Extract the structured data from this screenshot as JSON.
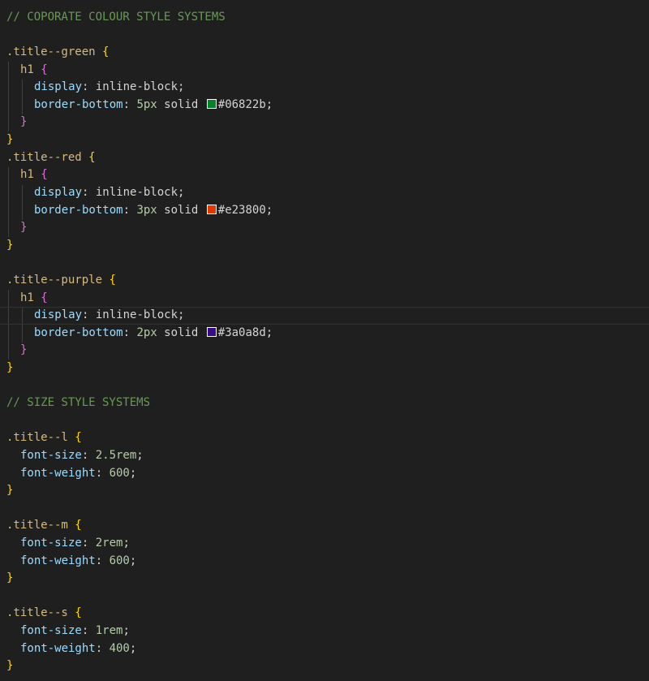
{
  "editor": {
    "comments": {
      "colour": "// COPORATE COLOUR STYLE SYSTEMS",
      "size": "// SIZE STYLE SYSTEMS"
    },
    "rules": {
      "green": {
        "selector": ".title--green",
        "tag": "h1",
        "display_prop": "display",
        "display_value": "inline-block",
        "border_prop": "border-bottom",
        "border_width": "5px",
        "border_style": "solid",
        "border_color": "#06822b"
      },
      "red": {
        "selector": ".title--red",
        "tag": "h1",
        "display_prop": "display",
        "display_value": "inline-block",
        "border_prop": "border-bottom",
        "border_width": "3px",
        "border_style": "solid",
        "border_color": "#e23800"
      },
      "purple": {
        "selector": ".title--purple",
        "tag": "h1",
        "display_prop": "display",
        "display_value": "inline-block",
        "border_prop": "border-bottom",
        "border_width": "2px",
        "border_style": "solid",
        "border_color": "#3a0a8d"
      },
      "l": {
        "selector": ".title--l",
        "size_prop": "font-size",
        "size_value": "2.5rem",
        "weight_prop": "font-weight",
        "weight_value": "600"
      },
      "m": {
        "selector": ".title--m",
        "size_prop": "font-size",
        "size_value": "2rem",
        "weight_prop": "font-weight",
        "weight_value": "600"
      },
      "s": {
        "selector": ".title--s",
        "size_prop": "font-size",
        "size_value": "1rem",
        "weight_prop": "font-weight",
        "weight_value": "400"
      }
    },
    "glyphs": {
      "open": "{",
      "close": "}",
      "colon": ": ",
      "semi": ";",
      "space": " "
    }
  },
  "colors": {
    "background": "#1f1f1f",
    "comment": "#6a9955",
    "selector": "#d7ba7d",
    "bracket_level1": "#ffd700",
    "bracket_level2": "#da70d6",
    "property": "#9cdcfe",
    "number": "#b5cea8",
    "swatch_green": "#06822b",
    "swatch_red": "#e23800",
    "swatch_purple": "#3a0a8d"
  }
}
